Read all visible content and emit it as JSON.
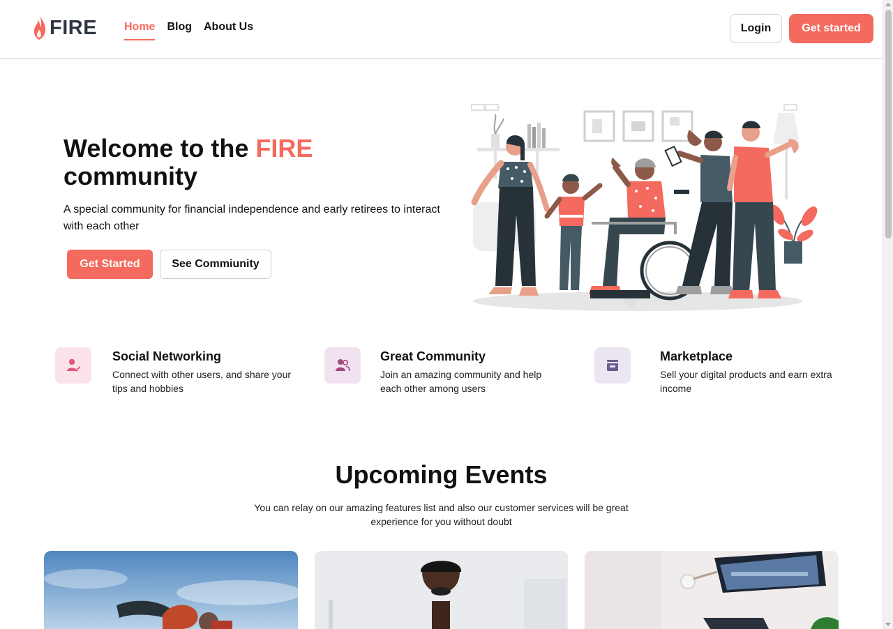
{
  "header": {
    "logo_text": "FIRE",
    "nav": [
      {
        "label": "Home",
        "active": true
      },
      {
        "label": "Blog",
        "active": false
      },
      {
        "label": "About Us",
        "active": false
      }
    ],
    "login_label": "Login",
    "get_started_label": "Get started"
  },
  "hero": {
    "title_prefix": "Welcome to the ",
    "title_accent": "FIRE",
    "title_suffix": "community",
    "subtitle": "A special community for financial independence and early retirees to interact with each other",
    "primary_button": "Get Started",
    "secondary_button": "See Commiunity"
  },
  "features": [
    {
      "icon": "user-check-icon",
      "title": "Social Networking",
      "description": "Connect with other users, and share your tips and hobbies",
      "icon_bg": "#fbe3ea",
      "icon_color": "#e0577f"
    },
    {
      "icon": "users-icon",
      "title": "Great Community",
      "description": "Join an amazing community and help each other among users",
      "icon_bg": "#f1e2ef",
      "icon_color": "#a3487f"
    },
    {
      "icon": "store-icon",
      "title": "Marketplace",
      "description": "Sell your digital products and earn extra income",
      "icon_bg": "#ebe6f1",
      "icon_color": "#6b5b8c"
    }
  ],
  "events": {
    "title": "Upcoming Events",
    "subtitle": "You can relay on our amazing features list and also our customer services will be great experience for you without doubt",
    "cards": [
      {
        "image": "outdoor-people-photo"
      },
      {
        "image": "man-portrait-photo"
      },
      {
        "image": "laptop-desk-photo"
      }
    ]
  },
  "colors": {
    "accent": "#f46a5e",
    "text": "#111111",
    "dark_illustration": "#37474f"
  }
}
